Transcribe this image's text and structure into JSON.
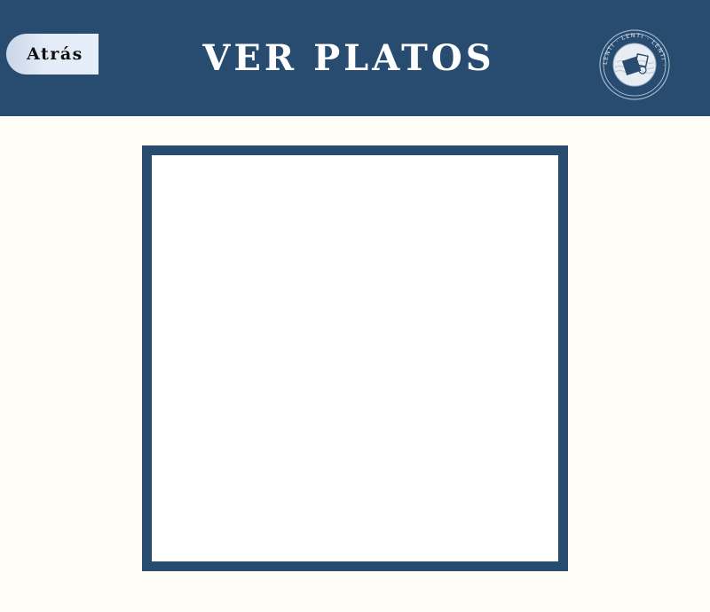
{
  "header": {
    "back_label": "Atrás",
    "title": "VER PLATOS",
    "logo": {
      "icon": "lenti-seal-logo",
      "ring_text": "LENTI · LENTI · LENTI ·"
    }
  },
  "colors": {
    "header_bg": "#274c6f",
    "page_bg": "#fffdf8",
    "frame_border": "#274c6f",
    "button_bg": "#e2ebf7"
  }
}
